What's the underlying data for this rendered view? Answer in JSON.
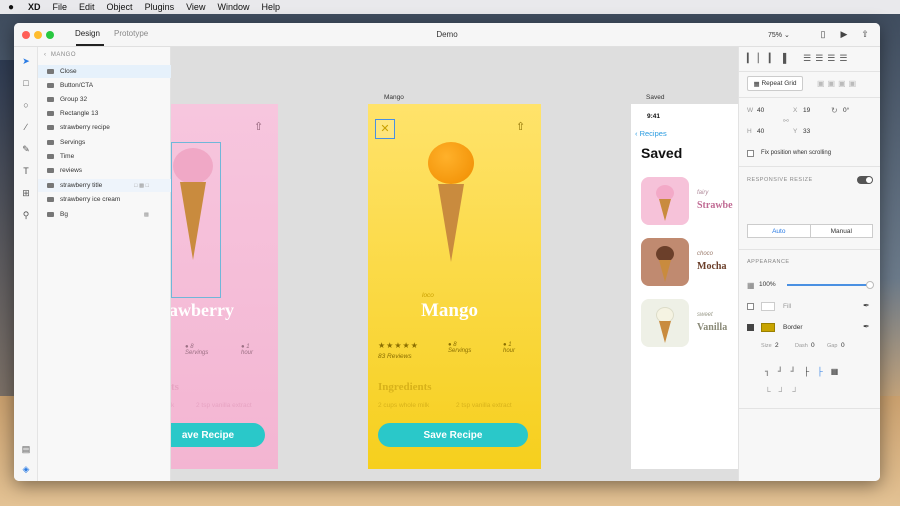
{
  "menubar": {
    "apple": "",
    "items": [
      "XD",
      "File",
      "Edit",
      "Object",
      "Plugins",
      "View",
      "Window",
      "Help"
    ]
  },
  "window": {
    "tabs": [
      "Design",
      "Prototype"
    ],
    "title": "Demo",
    "zoom": "75%"
  },
  "layers": {
    "header": "MANGO",
    "items": [
      "Close",
      "Button/CTA",
      "Group 32",
      "Rectangle 13",
      "strawberry recipe",
      "Servings",
      "Time",
      "reviews",
      "strawberry title",
      "strawberry ice cream",
      "Bg"
    ]
  },
  "canvas": {
    "artboards": {
      "mango": "Mango",
      "saved": "Saved"
    },
    "pink": {
      "title": "awberry",
      "servings_num": "8",
      "servings": "Servings",
      "hour_num": "1",
      "hour": "hour",
      "ingredients": "ts",
      "line1": "k",
      "line2": "2 tsp vanilla extract",
      "cta": "ave Recipe"
    },
    "yellow": {
      "kicker": "loco",
      "title": "Mango",
      "stars": "★★★★★",
      "reviews": "83 Reviews",
      "servings_num": "8",
      "servings": "Servings",
      "hour_num": "1",
      "hour": "hour",
      "ingredients": "Ingredients",
      "line1": "2 cups whole milk",
      "line2": "2 tsp vanilla extract",
      "cta": "Save Recipe"
    },
    "saved": {
      "time": "9:41",
      "back": "Recipes",
      "heading": "Saved",
      "items": [
        {
          "kicker": "fairy",
          "name": "Strawbe"
        },
        {
          "kicker": "choco",
          "name": "Mocha"
        },
        {
          "kicker": "sweet",
          "name": "Vanilla"
        }
      ]
    }
  },
  "inspector": {
    "repeat_grid": "Repeat Grid",
    "w_label": "W",
    "w_value": "40",
    "x_label": "X",
    "x_value": "19",
    "rot_value": "0°",
    "h_label": "H",
    "h_value": "40",
    "y_label": "Y",
    "y_value": "33",
    "fix_position": "Fix position when scrolling",
    "responsive_resize": "RESPONSIVE RESIZE",
    "resize_auto": "Auto",
    "resize_manual": "Manual",
    "appearance": "APPEARANCE",
    "opacity": "100%",
    "fill": "Fill",
    "border": "Border",
    "size_label": "Size",
    "size_value": "2",
    "dash_label": "Dash",
    "dash_value": "0",
    "gap_label": "Gap",
    "gap_value": "0"
  },
  "colors": {
    "accent": "#2ac8c9",
    "border_swatch": "#c8a400",
    "selection": "#4a90e2"
  }
}
